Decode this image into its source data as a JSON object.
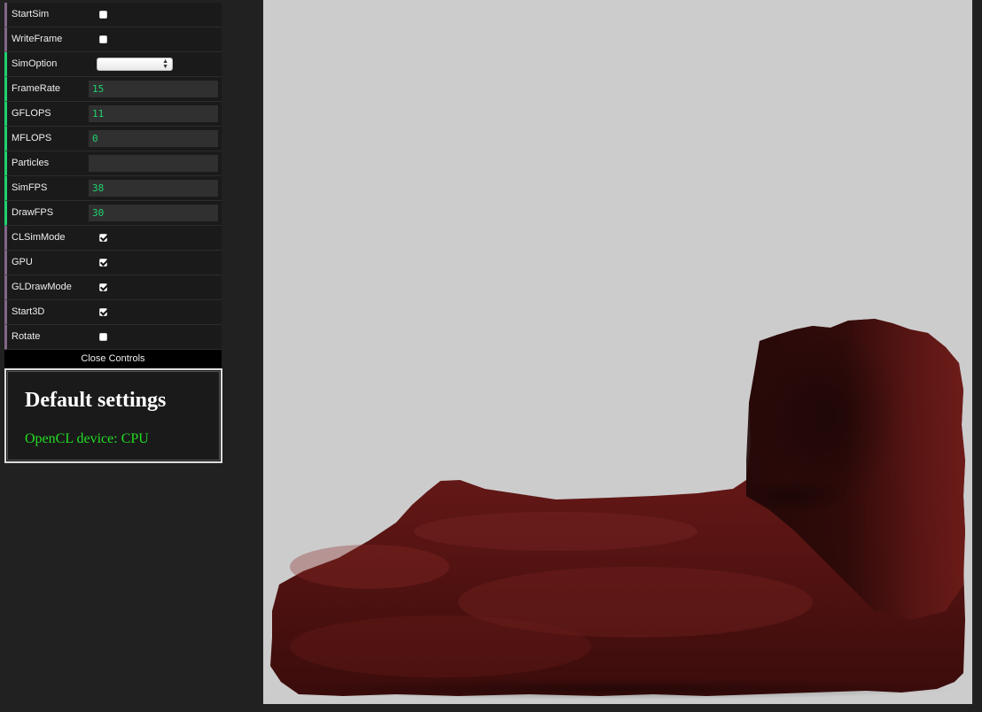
{
  "controls": [
    {
      "id": "startsim",
      "label": "StartSim",
      "kind": "checkbox",
      "checked": false
    },
    {
      "id": "writeframe",
      "label": "WriteFrame",
      "kind": "checkbox",
      "checked": false
    },
    {
      "id": "simoption",
      "label": "SimOption",
      "kind": "select",
      "value": ""
    },
    {
      "id": "framerate",
      "label": "FrameRate",
      "kind": "number",
      "value": "15"
    },
    {
      "id": "gflops",
      "label": "GFLOPS",
      "kind": "number",
      "value": "11"
    },
    {
      "id": "mflops",
      "label": "MFLOPS",
      "kind": "number",
      "value": "0"
    },
    {
      "id": "particles",
      "label": "Particles",
      "kind": "number",
      "value": ""
    },
    {
      "id": "simfps",
      "label": "SimFPS",
      "kind": "number",
      "value": "38"
    },
    {
      "id": "drawfps",
      "label": "DrawFPS",
      "kind": "number",
      "value": "30"
    },
    {
      "id": "clsimmode",
      "label": "CLSimMode",
      "kind": "checkbox",
      "checked": true
    },
    {
      "id": "gpu",
      "label": "GPU",
      "kind": "checkbox",
      "checked": true
    },
    {
      "id": "gldrawmode",
      "label": "GLDrawMode",
      "kind": "checkbox",
      "checked": true
    },
    {
      "id": "start3d",
      "label": "Start3D",
      "kind": "checkbox",
      "checked": true
    },
    {
      "id": "rotate",
      "label": "Rotate",
      "kind": "checkbox",
      "checked": false
    }
  ],
  "close_controls_label": "Close Controls",
  "info": {
    "heading": "Default settings",
    "device_text": "OpenCL device: CPU"
  },
  "colors": {
    "panel_bg": "#1a1a1a",
    "page_bg": "#212121",
    "viewport_bg": "#cccccc",
    "fluid": "#6b1a18",
    "value_text": "#1ed36f",
    "device_text": "#22dd22"
  }
}
